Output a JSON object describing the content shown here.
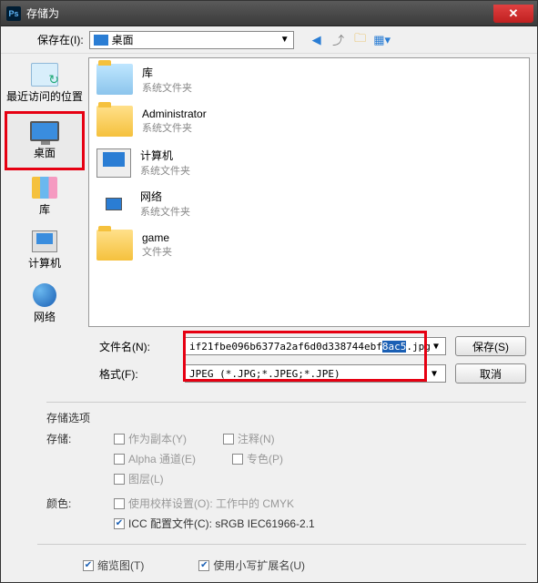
{
  "titlebar": {
    "icon_text": "Ps",
    "title": "存储为"
  },
  "toolbar": {
    "save_in_label": "保存在(I):",
    "path_text": "桌面"
  },
  "sidebar": {
    "places": [
      {
        "label": "最近访问的位置"
      },
      {
        "label": "桌面"
      },
      {
        "label": "库"
      },
      {
        "label": "计算机"
      },
      {
        "label": "网络"
      }
    ]
  },
  "filelist": {
    "items": [
      {
        "name": "库",
        "sub": "系统文件夹",
        "icon": "lib"
      },
      {
        "name": "Administrator",
        "sub": "系统文件夹",
        "icon": "folder"
      },
      {
        "name": "计算机",
        "sub": "系统文件夹",
        "icon": "computer"
      },
      {
        "name": "网络",
        "sub": "系统文件夹",
        "icon": "network"
      },
      {
        "name": "game",
        "sub": "文件夹",
        "icon": "folder"
      }
    ]
  },
  "fields": {
    "filename_label": "文件名(N):",
    "filename_prefix": "if21fbe096b6377a2af6d0d338744ebf",
    "filename_selected": "8ac5",
    "filename_suffix": ".jpg",
    "format_label": "格式(F):",
    "format_value": "JPEG (*.JPG;*.JPEG;*.JPE)",
    "save_btn": "保存(S)",
    "cancel_btn": "取消"
  },
  "options": {
    "section_label": "存储选项",
    "save_label": "存储:",
    "as_copy": "作为副本(Y)",
    "notes": "注释(N)",
    "alpha": "Alpha 通道(E)",
    "spot": "专色(P)",
    "layers": "图层(L)",
    "color_label": "颜色:",
    "proof": "使用校样设置(O): 工作中的 CMYK",
    "icc": "ICC 配置文件(C): sRGB IEC61966-2.1",
    "thumbnail": "缩览图(T)",
    "lowercase_ext": "使用小写扩展名(U)"
  }
}
